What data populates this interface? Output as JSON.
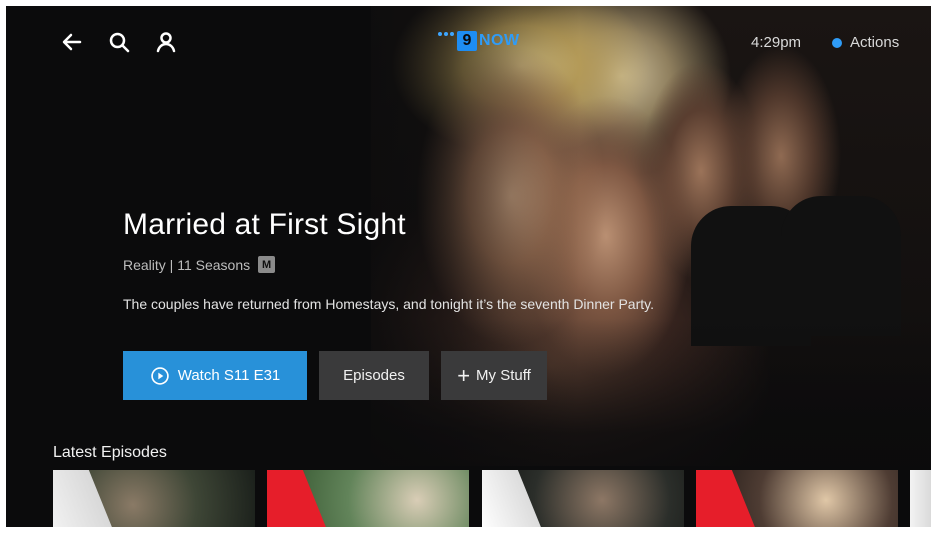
{
  "header": {
    "logo_text": "NOW",
    "logo_digit": "9",
    "clock": "4:29pm",
    "actions_label": "Actions",
    "icons": [
      "back-arrow-icon",
      "search-icon",
      "profile-icon"
    ]
  },
  "show": {
    "title": "Married at First Sight",
    "meta": "Reality | 11 Seasons",
    "rating": "M",
    "description": "The couples have returned from Homestays, and tonight it’s the seventh Dinner Party."
  },
  "buttons": {
    "watch_label": "Watch S11 E31",
    "episodes_label": "Episodes",
    "my_stuff_label": "My Stuff",
    "my_stuff_prefix": "+"
  },
  "latest": {
    "title": "Latest Episodes",
    "items": [
      {
        "accent": "white"
      },
      {
        "accent": "red"
      },
      {
        "accent": "white"
      },
      {
        "accent": "red"
      },
      {
        "accent": "white"
      }
    ]
  },
  "colors": {
    "accent_blue": "#2891d9",
    "brand_blue": "#2f9cf7",
    "secondary_button": "#3a3a3b",
    "background": "#0b0b0c"
  }
}
